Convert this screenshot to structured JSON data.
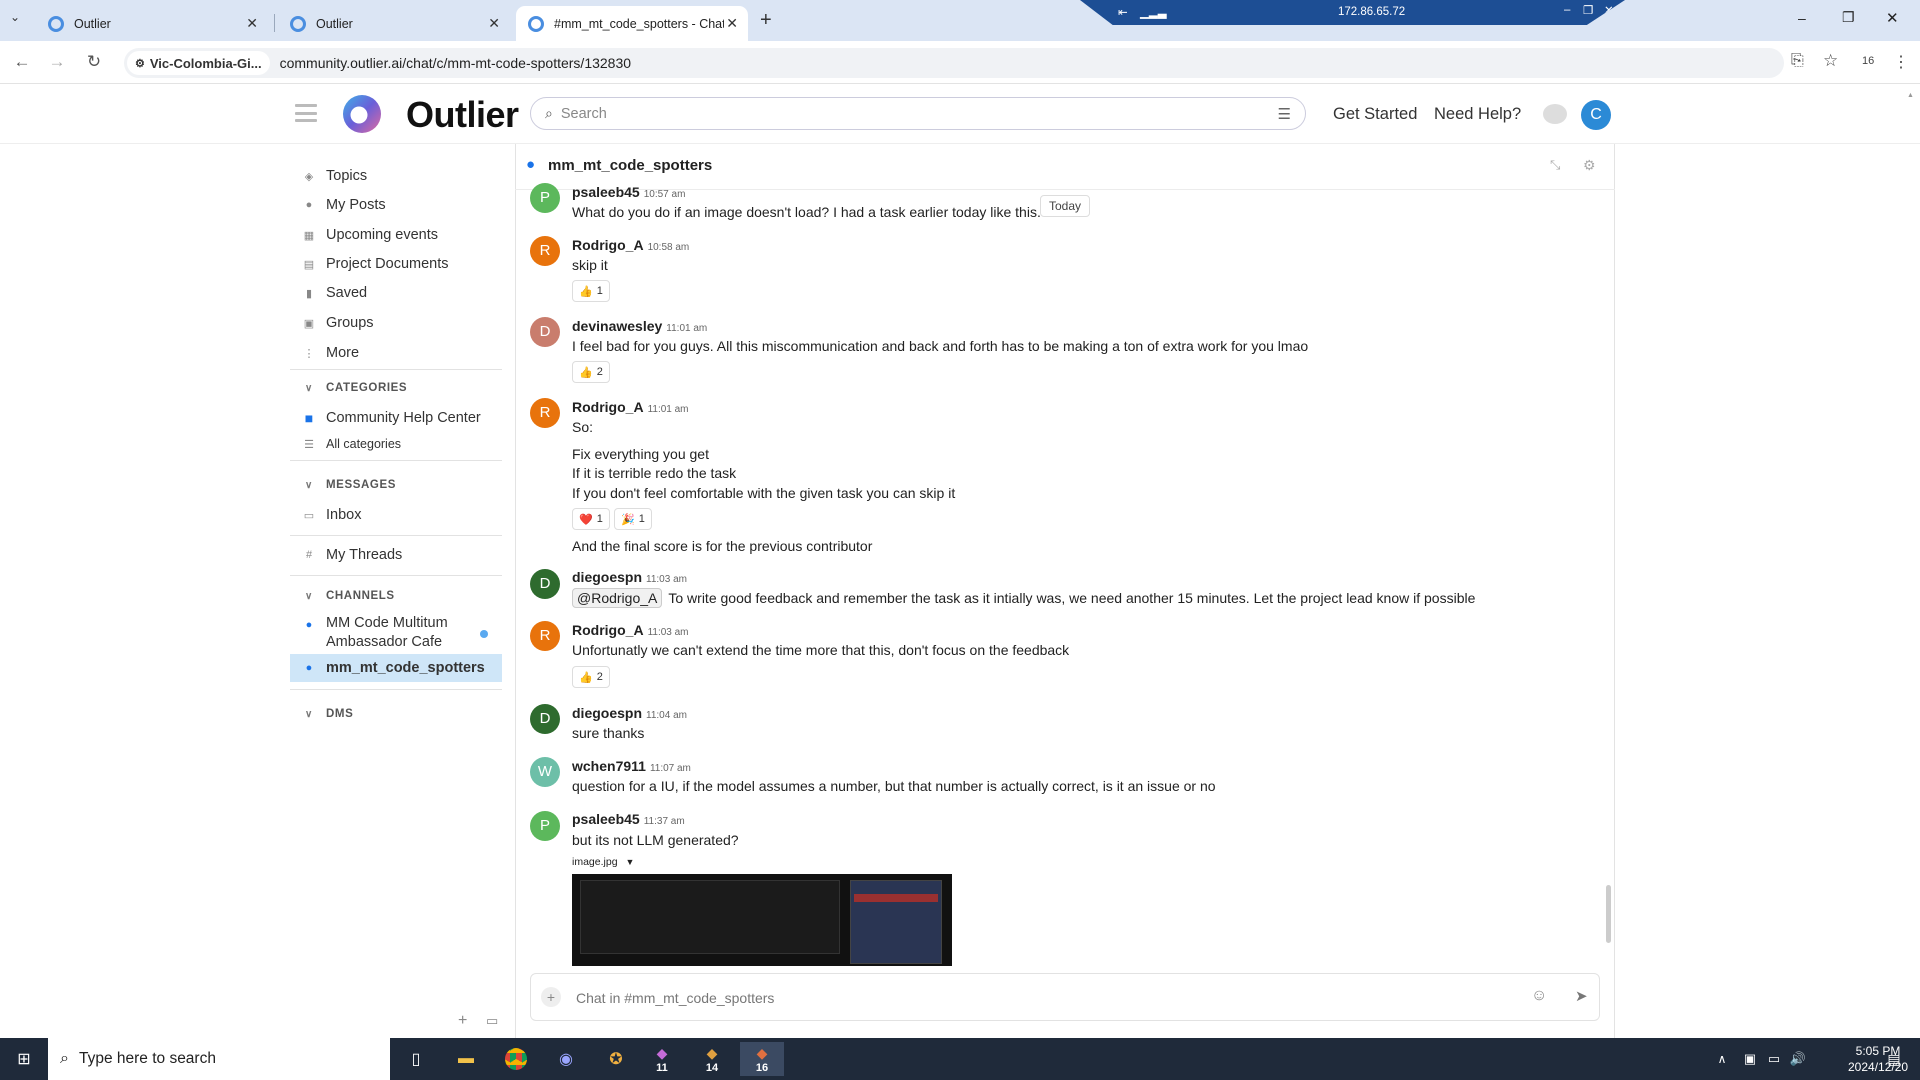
{
  "browser": {
    "tabs": [
      {
        "title": "Outlier",
        "active": false
      },
      {
        "title": "Outlier",
        "active": false
      },
      {
        "title": "#mm_mt_code_spotters - Chat",
        "active": true
      }
    ],
    "remote_ip": "172.86.65.72",
    "site_chip": "Vic-Colombia-Gi...",
    "url": "community.outlier.ai/chat/c/mm-mt-code-spotters/132830",
    "badge_count": "16"
  },
  "header": {
    "logo_text": "Outlier",
    "search_placeholder": "Search",
    "get_started": "Get Started",
    "need_help": "Need Help?",
    "user_initial": "C"
  },
  "sidebar": {
    "nav": [
      {
        "label": "Topics",
        "icon": "layers-icon"
      },
      {
        "label": "My Posts",
        "icon": "user-icon"
      },
      {
        "label": "Upcoming events",
        "icon": "calendar-icon"
      },
      {
        "label": "Project Documents",
        "icon": "document-icon"
      },
      {
        "label": "Saved",
        "icon": "bookmark-icon"
      },
      {
        "label": "Groups",
        "icon": "users-icon"
      },
      {
        "label": "More",
        "icon": "more-vertical-icon"
      }
    ],
    "categories_heading": "CATEGORIES",
    "categories": [
      {
        "label": "Community Help Center",
        "color": "#1a73e8"
      },
      {
        "label": "All categories"
      }
    ],
    "messages_heading": "MESSAGES",
    "messages": [
      {
        "label": "Inbox"
      },
      {
        "label": "My Threads"
      }
    ],
    "channels_heading": "CHANNELS",
    "channels": [
      {
        "label": "MM Code Multitum Ambassador Cafe",
        "unread": true
      },
      {
        "label": "mm_mt_code_spotters",
        "active": true
      }
    ],
    "dms_heading": "DMS"
  },
  "chat": {
    "channel_title": "mm_mt_code_spotters",
    "today_label": "Today",
    "messages": [
      {
        "user": "psaleeb45",
        "time": "10:57 am",
        "initial": "P",
        "avatar_color": "#5cb85c",
        "lines": [
          "What do you do if an image doesn't load? I had a task earlier today like this."
        ]
      },
      {
        "user": "Rodrigo_A",
        "time": "10:58 am",
        "initial": "R",
        "avatar_color": "#e8730c",
        "lines": [
          "skip it"
        ],
        "reactions": [
          {
            "emoji": "👍",
            "count": "1"
          }
        ]
      },
      {
        "user": "devinawesley",
        "time": "11:01 am",
        "initial": "D",
        "avatar_color": "#c97d6d",
        "lines": [
          "I feel bad for you guys. All this miscommunication and back and forth has to be making a ton of extra work for you lmao"
        ],
        "reactions": [
          {
            "emoji": "👍",
            "count": "2"
          }
        ]
      },
      {
        "user": "Rodrigo_A",
        "time": "11:01 am",
        "initial": "R",
        "avatar_color": "#e8730c",
        "lines": [
          "So:",
          "Fix everything you get",
          "If it is terrible redo the task",
          "If you don't feel comfortable with the given task you can skip it"
        ],
        "reactions": [
          {
            "emoji": "❤️",
            "count": "1"
          },
          {
            "emoji": "🎉",
            "count": "1"
          }
        ],
        "followup": "And the final score is for the previous contributor"
      },
      {
        "user": "diegoespn",
        "time": "11:03 am",
        "initial": "D",
        "avatar_color": "#2e6b2e",
        "mention": "@Rodrigo_A",
        "lines": [
          "To write good feedback and remember the task as it intially was, we need another 15 minutes. Let the project lead know if possible"
        ]
      },
      {
        "user": "Rodrigo_A",
        "time": "11:03 am",
        "initial": "R",
        "avatar_color": "#e8730c",
        "lines": [
          "Unfortunatly we can't extend the time more that this, don't focus on the feedback"
        ],
        "reactions": [
          {
            "emoji": "👍",
            "count": "2"
          }
        ]
      },
      {
        "user": "diegoespn",
        "time": "11:04 am",
        "initial": "D",
        "avatar_color": "#2e6b2e",
        "lines": [
          "sure thanks"
        ]
      },
      {
        "user": "wchen7911",
        "time": "11:07 am",
        "initial": "W",
        "avatar_color": "#6dbfa8",
        "lines": [
          "question for a IU, if the model assumes a number, but that number is actually correct, is it an issue or no"
        ]
      },
      {
        "user": "psaleeb45",
        "time": "11:37 am",
        "initial": "P",
        "avatar_color": "#5cb85c",
        "lines": [
          "but its not LLM generated?"
        ],
        "attachment": "image.jpg"
      }
    ],
    "composer_placeholder": "Chat in #mm_mt_code_spotters"
  },
  "taskbar": {
    "search_placeholder": "Type here to search",
    "badges": [
      "11",
      "14",
      "16"
    ],
    "time": "5:05 PM",
    "date": "2024/12/20"
  }
}
